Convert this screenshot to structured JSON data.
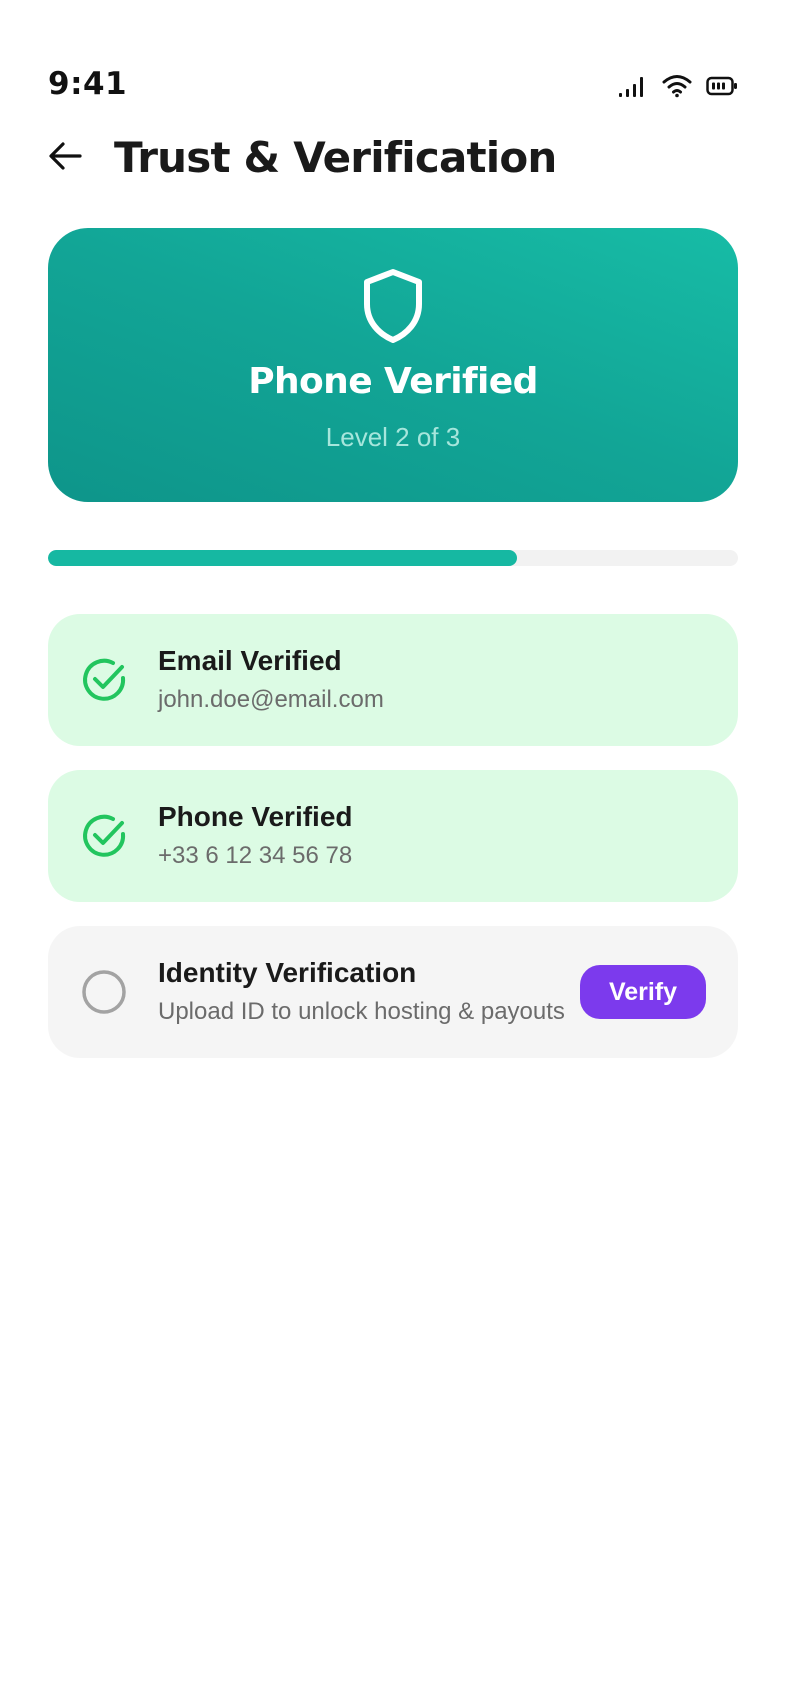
{
  "status_bar": {
    "time": "9:41",
    "icons": [
      "cellular-signal-icon",
      "wifi-icon",
      "battery-icon"
    ]
  },
  "header": {
    "back_icon": "arrow-left-icon",
    "title": "Trust & Verification"
  },
  "hero": {
    "icon": "shield-icon",
    "title": "Phone Verified",
    "subtitle": "Level 2 of 3",
    "gradient_colors": [
      "#17bca6",
      "#0e958a"
    ]
  },
  "progress": {
    "fraction": 0.68,
    "color": "#16b8a2"
  },
  "verification_items": [
    {
      "status": "complete",
      "icon": "check-circle-icon",
      "title": "Email Verified",
      "subtitle": "john.doe@email.com"
    },
    {
      "status": "complete",
      "icon": "check-circle-icon",
      "title": "Phone Verified",
      "subtitle": "+33 6 12 34 56 78"
    },
    {
      "status": "pending",
      "icon": "empty-circle-icon",
      "title": "Identity Verification",
      "subtitle": "Upload ID to unlock hosting & payouts",
      "action_label": "Verify"
    }
  ],
  "colors": {
    "complete_bg": "#dcfbe4",
    "pending_bg": "#f5f5f5",
    "check_green": "#22c55e",
    "accent_purple": "#7c3aed"
  }
}
